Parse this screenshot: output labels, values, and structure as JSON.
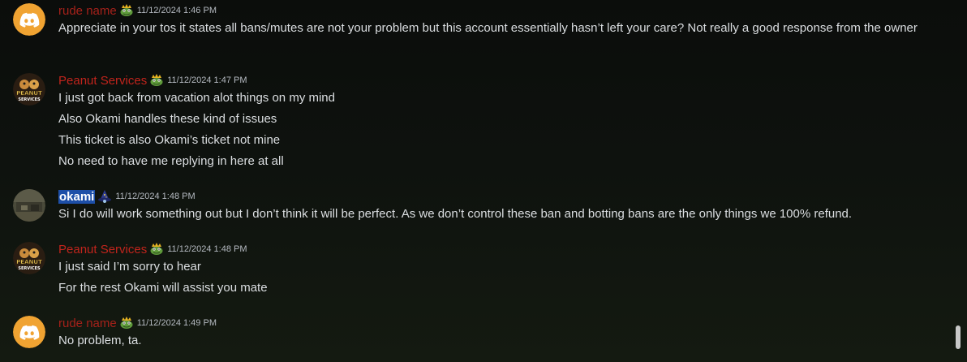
{
  "messages": [
    {
      "username": "rude name",
      "avatar": "discord-logo-icon",
      "role_icon": "frog-crown-icon",
      "timestamp": "11/12/2024 1:46 PM",
      "lines": [
        "Appreciate in your tos it states all bans/mutes are not your problem but this account essentially hasn’t left your care? Not really a good response from the owner"
      ]
    },
    {
      "username": "Peanut Services",
      "avatar": "peanut-services-logo",
      "avatar_text": [
        "PEANUT",
        "SERVICES"
      ],
      "role_icon": "frog-crown-icon",
      "timestamp": "11/12/2024 1:47 PM",
      "lines": [
        "I just got back from vacation alot things on my mind",
        "Also Okami handles these kind of issues",
        "This ticket is also Okami’s ticket not mine",
        "No need to have me replying in here at all"
      ]
    },
    {
      "username": "okami",
      "avatar": "okami-photo",
      "role_icon": "wizard-hat-icon",
      "timestamp": "11/12/2024 1:48 PM",
      "lines": [
        "Si I do will work something out but I don’t think it will be perfect.  As we don’t control these ban and botting bans are the only things we 100% refund."
      ]
    },
    {
      "username": "Peanut Services",
      "avatar": "peanut-services-logo",
      "avatar_text": [
        "PEANUT",
        "SERVICES"
      ],
      "role_icon": "frog-crown-icon",
      "timestamp": "11/12/2024 1:48 PM",
      "lines": [
        "I just said I’m sorry to hear",
        "For the rest Okami will assist you mate"
      ]
    },
    {
      "username": "rude name",
      "avatar": "discord-logo-icon",
      "role_icon": "frog-crown-icon",
      "timestamp": "11/12/2024 1:49 PM",
      "lines": [
        "No problem, ta."
      ]
    }
  ],
  "colors": {
    "discord_avatar_bg": "#f0a332",
    "name_red": "#c0241c",
    "selection": "#1d4fa8"
  }
}
